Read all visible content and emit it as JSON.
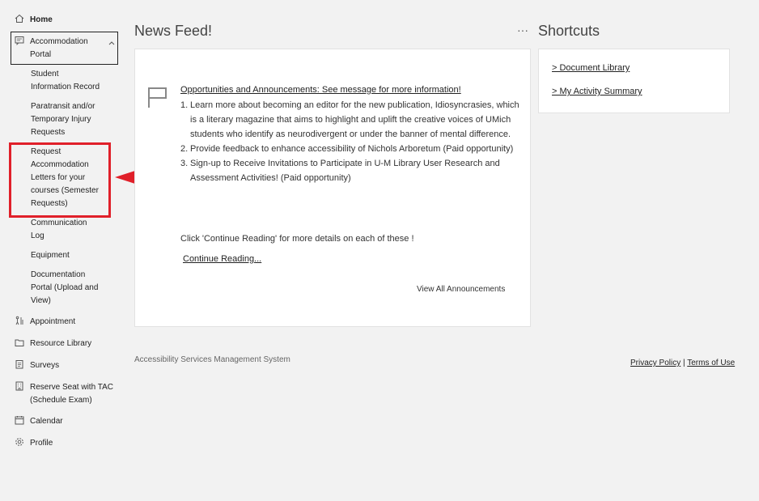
{
  "sidebar": {
    "home": "Home",
    "portal": "Accommodation\nPortal",
    "portal_items": [
      "Student\nInformation Record",
      "Paratransit and/or\nTemporary Injury\nRequests",
      "Request\nAccommodation\nLetters for your\ncourses (Semester\nRequests)",
      "Communication\nLog",
      "Equipment",
      "Documentation\nPortal (Upload and\nView)"
    ],
    "appointment": "Appointment",
    "resource_library": "Resource Library",
    "surveys": "Surveys",
    "reserve_seat": "Reserve Seat with TAC\n(Schedule Exam)",
    "calendar": "Calendar",
    "profile": "Profile"
  },
  "news": {
    "title": "News Feed!",
    "more": "···",
    "heading": "Opportunities and Announcements: See message for more information!",
    "items": [
      {
        "num": "1.",
        "text": "Learn more about becoming an editor for the new  publication, Idiosyncrasies, which is a literary magazine that aims to highlight and uplift the creative voices of UMich students who identify as neurodivergent or under the banner of mental difference."
      },
      {
        "num": "2.",
        "text": "Provide feedback to enhance accessibility of Nichols Arboretum (Paid opportunity)"
      },
      {
        "num": "3.",
        "text": "Sign-up to Receive Invitations to Participate in U-M Library User Research and Assessment Activities! (Paid opportunity)"
      }
    ],
    "footer_text": "Click 'Continue Reading' for more details on each of these !",
    "continue": "Continue Reading...",
    "view_all": "View All Announcements"
  },
  "shortcuts": {
    "title": "Shortcuts",
    "links": [
      "> Document Library",
      "> My Activity Summary"
    ]
  },
  "footer": {
    "system_name": "Accessibility Services Management System",
    "privacy": "Privacy Policy",
    "separator": "|",
    "terms": "Terms of Use"
  },
  "colors": {
    "highlight": "#e0202a",
    "background": "#f2f2f2"
  }
}
